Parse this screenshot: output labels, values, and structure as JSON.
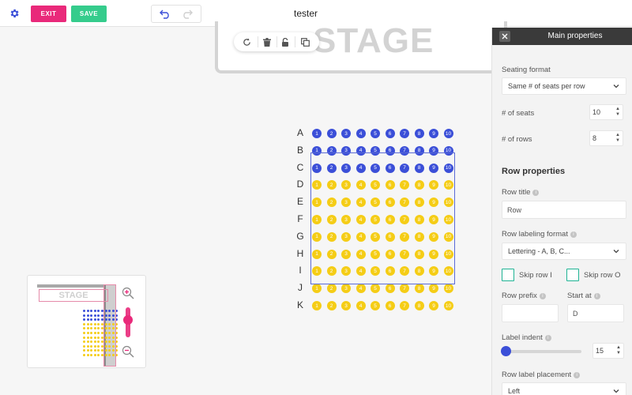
{
  "topbar": {
    "exit_label": "EXIT",
    "save_label": "SAVE",
    "title": "tester"
  },
  "stage": {
    "label": "STAGE"
  },
  "seating": {
    "rows": [
      "A",
      "B",
      "C",
      "D",
      "E",
      "F",
      "G",
      "H",
      "I",
      "J",
      "K"
    ],
    "seats_per_row": 10,
    "blue_rows": [
      "A",
      "B",
      "C"
    ],
    "yellow_rows": [
      "D",
      "E",
      "F",
      "G",
      "H",
      "I",
      "J",
      "K"
    ],
    "selected_rows": [
      "D",
      "E",
      "F",
      "G",
      "H",
      "I",
      "J",
      "K"
    ]
  },
  "minimap": {
    "stage_label": "STAGE"
  },
  "panel": {
    "title": "Main properties",
    "seating_format_label": "Seating format",
    "seating_format_value": "Same # of seats per row",
    "seats_label": "# of seats",
    "seats_value": "10",
    "rows_label": "# of rows",
    "rows_value": "8",
    "row_properties_title": "Row properties",
    "row_title_label": "Row title",
    "row_title_value": "Row",
    "row_labeling_label": "Row labeling format",
    "row_labeling_value": "Lettering - A, B, C...",
    "skip_i_label": "Skip row I",
    "skip_o_label": "Skip row O",
    "row_prefix_label": "Row prefix",
    "row_prefix_value": "",
    "start_at_label": "Start at",
    "start_at_value": "D",
    "label_indent_label": "Label indent",
    "label_indent_value": "15",
    "label_placement_label": "Row label placement",
    "label_placement_value": "Left"
  },
  "colors": {
    "exit": "#e9297a",
    "save": "#35cc8c",
    "seat_blue": "#3b4fd8",
    "seat_yellow": "#f5cd16",
    "checkbox": "#1fb494"
  }
}
